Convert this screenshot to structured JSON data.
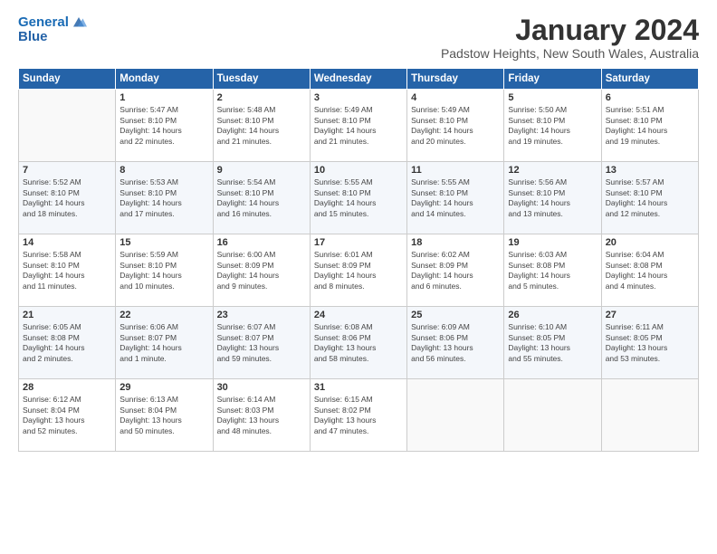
{
  "logo": {
    "line1": "General",
    "line2": "Blue"
  },
  "title": "January 2024",
  "subtitle": "Padstow Heights, New South Wales, Australia",
  "days_header": [
    "Sunday",
    "Monday",
    "Tuesday",
    "Wednesday",
    "Thursday",
    "Friday",
    "Saturday"
  ],
  "weeks": [
    [
      {
        "num": "",
        "info": ""
      },
      {
        "num": "1",
        "info": "Sunrise: 5:47 AM\nSunset: 8:10 PM\nDaylight: 14 hours\nand 22 minutes."
      },
      {
        "num": "2",
        "info": "Sunrise: 5:48 AM\nSunset: 8:10 PM\nDaylight: 14 hours\nand 21 minutes."
      },
      {
        "num": "3",
        "info": "Sunrise: 5:49 AM\nSunset: 8:10 PM\nDaylight: 14 hours\nand 21 minutes."
      },
      {
        "num": "4",
        "info": "Sunrise: 5:49 AM\nSunset: 8:10 PM\nDaylight: 14 hours\nand 20 minutes."
      },
      {
        "num": "5",
        "info": "Sunrise: 5:50 AM\nSunset: 8:10 PM\nDaylight: 14 hours\nand 19 minutes."
      },
      {
        "num": "6",
        "info": "Sunrise: 5:51 AM\nSunset: 8:10 PM\nDaylight: 14 hours\nand 19 minutes."
      }
    ],
    [
      {
        "num": "7",
        "info": "Sunrise: 5:52 AM\nSunset: 8:10 PM\nDaylight: 14 hours\nand 18 minutes."
      },
      {
        "num": "8",
        "info": "Sunrise: 5:53 AM\nSunset: 8:10 PM\nDaylight: 14 hours\nand 17 minutes."
      },
      {
        "num": "9",
        "info": "Sunrise: 5:54 AM\nSunset: 8:10 PM\nDaylight: 14 hours\nand 16 minutes."
      },
      {
        "num": "10",
        "info": "Sunrise: 5:55 AM\nSunset: 8:10 PM\nDaylight: 14 hours\nand 15 minutes."
      },
      {
        "num": "11",
        "info": "Sunrise: 5:55 AM\nSunset: 8:10 PM\nDaylight: 14 hours\nand 14 minutes."
      },
      {
        "num": "12",
        "info": "Sunrise: 5:56 AM\nSunset: 8:10 PM\nDaylight: 14 hours\nand 13 minutes."
      },
      {
        "num": "13",
        "info": "Sunrise: 5:57 AM\nSunset: 8:10 PM\nDaylight: 14 hours\nand 12 minutes."
      }
    ],
    [
      {
        "num": "14",
        "info": "Sunrise: 5:58 AM\nSunset: 8:10 PM\nDaylight: 14 hours\nand 11 minutes."
      },
      {
        "num": "15",
        "info": "Sunrise: 5:59 AM\nSunset: 8:10 PM\nDaylight: 14 hours\nand 10 minutes."
      },
      {
        "num": "16",
        "info": "Sunrise: 6:00 AM\nSunset: 8:09 PM\nDaylight: 14 hours\nand 9 minutes."
      },
      {
        "num": "17",
        "info": "Sunrise: 6:01 AM\nSunset: 8:09 PM\nDaylight: 14 hours\nand 8 minutes."
      },
      {
        "num": "18",
        "info": "Sunrise: 6:02 AM\nSunset: 8:09 PM\nDaylight: 14 hours\nand 6 minutes."
      },
      {
        "num": "19",
        "info": "Sunrise: 6:03 AM\nSunset: 8:08 PM\nDaylight: 14 hours\nand 5 minutes."
      },
      {
        "num": "20",
        "info": "Sunrise: 6:04 AM\nSunset: 8:08 PM\nDaylight: 14 hours\nand 4 minutes."
      }
    ],
    [
      {
        "num": "21",
        "info": "Sunrise: 6:05 AM\nSunset: 8:08 PM\nDaylight: 14 hours\nand 2 minutes."
      },
      {
        "num": "22",
        "info": "Sunrise: 6:06 AM\nSunset: 8:07 PM\nDaylight: 14 hours\nand 1 minute."
      },
      {
        "num": "23",
        "info": "Sunrise: 6:07 AM\nSunset: 8:07 PM\nDaylight: 13 hours\nand 59 minutes."
      },
      {
        "num": "24",
        "info": "Sunrise: 6:08 AM\nSunset: 8:06 PM\nDaylight: 13 hours\nand 58 minutes."
      },
      {
        "num": "25",
        "info": "Sunrise: 6:09 AM\nSunset: 8:06 PM\nDaylight: 13 hours\nand 56 minutes."
      },
      {
        "num": "26",
        "info": "Sunrise: 6:10 AM\nSunset: 8:05 PM\nDaylight: 13 hours\nand 55 minutes."
      },
      {
        "num": "27",
        "info": "Sunrise: 6:11 AM\nSunset: 8:05 PM\nDaylight: 13 hours\nand 53 minutes."
      }
    ],
    [
      {
        "num": "28",
        "info": "Sunrise: 6:12 AM\nSunset: 8:04 PM\nDaylight: 13 hours\nand 52 minutes."
      },
      {
        "num": "29",
        "info": "Sunrise: 6:13 AM\nSunset: 8:04 PM\nDaylight: 13 hours\nand 50 minutes."
      },
      {
        "num": "30",
        "info": "Sunrise: 6:14 AM\nSunset: 8:03 PM\nDaylight: 13 hours\nand 48 minutes."
      },
      {
        "num": "31",
        "info": "Sunrise: 6:15 AM\nSunset: 8:02 PM\nDaylight: 13 hours\nand 47 minutes."
      },
      {
        "num": "",
        "info": ""
      },
      {
        "num": "",
        "info": ""
      },
      {
        "num": "",
        "info": ""
      }
    ]
  ]
}
